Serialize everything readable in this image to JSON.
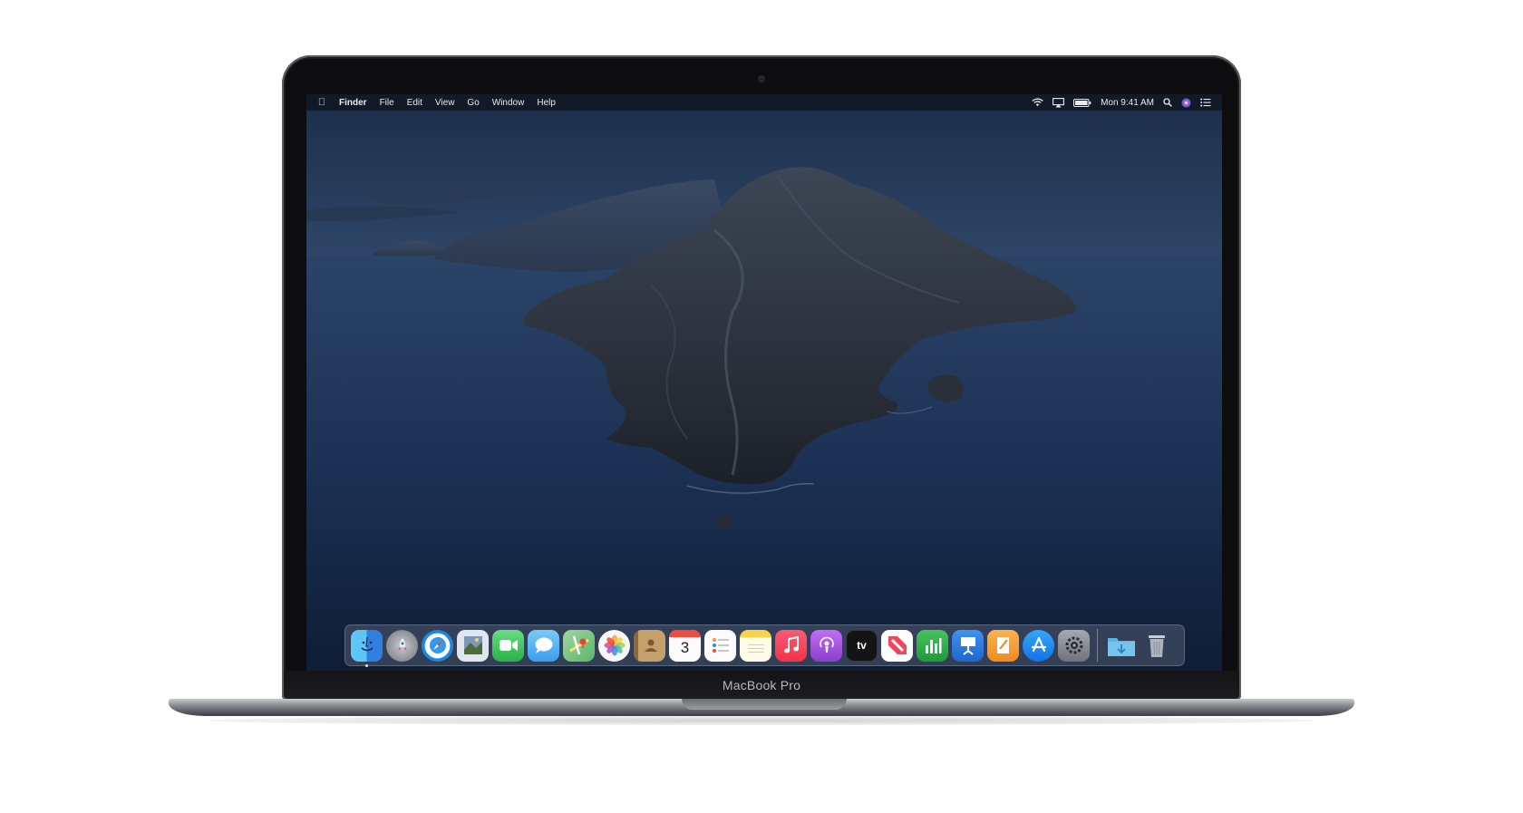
{
  "device": {
    "brand_label": "MacBook Pro"
  },
  "menubar": {
    "apple_icon": "apple-logo-icon",
    "app_name": "Finder",
    "menus": [
      "File",
      "Edit",
      "View",
      "Go",
      "Window",
      "Help"
    ],
    "clock": "Mon 9:41 AM",
    "status_icons": [
      "wifi-icon",
      "airplay-icon",
      "battery-icon",
      "spotlight-search-icon",
      "siri-icon",
      "notification-center-icon"
    ]
  },
  "dock": {
    "apps": [
      {
        "name": "Finder",
        "icon": "finder-icon",
        "color": "#2f8be6"
      },
      {
        "name": "Launchpad",
        "icon": "launchpad-icon",
        "color": "#8a8f98"
      },
      {
        "name": "Safari",
        "icon": "safari-icon",
        "color": "#1d86e0"
      },
      {
        "name": "Photo Booth",
        "icon": "photo-booth-icon",
        "color": "#b8c3d6"
      },
      {
        "name": "FaceTime",
        "icon": "facetime-icon",
        "color": "#35c759"
      },
      {
        "name": "Messages",
        "icon": "messages-icon",
        "color": "#5fb7f5"
      },
      {
        "name": "Maps",
        "icon": "maps-icon",
        "color": "#6fc37b"
      },
      {
        "name": "Photos",
        "icon": "photos-icon",
        "color": "#f2f2f2"
      },
      {
        "name": "Contacts",
        "icon": "contacts-icon",
        "color": "#b9975d"
      },
      {
        "name": "Calendar",
        "icon": "calendar-icon",
        "color": "#f7f7f7",
        "label": "3"
      },
      {
        "name": "Reminders",
        "icon": "reminders-icon",
        "color": "#f5f5f5"
      },
      {
        "name": "Notes",
        "icon": "notes-icon",
        "color": "#f9df6b"
      },
      {
        "name": "Music",
        "icon": "music-icon",
        "color": "#f54a64"
      },
      {
        "name": "Podcasts",
        "icon": "podcasts-icon",
        "color": "#9b4ed6"
      },
      {
        "name": "TV",
        "icon": "apple-tv-icon",
        "color": "#1b1b1d",
        "label": "tv"
      },
      {
        "name": "News",
        "icon": "news-icon",
        "color": "#f34559"
      },
      {
        "name": "Numbers",
        "icon": "numbers-icon",
        "color": "#2bb34a"
      },
      {
        "name": "Keynote",
        "icon": "keynote-icon",
        "color": "#2a7cde"
      },
      {
        "name": "Pages",
        "icon": "pages-icon",
        "color": "#f39b2f"
      },
      {
        "name": "App Store",
        "icon": "app-store-icon",
        "color": "#1a8af5"
      },
      {
        "name": "System Preferences",
        "icon": "system-preferences-icon",
        "color": "#8e9298"
      }
    ],
    "trailing": [
      {
        "name": "Downloads",
        "icon": "downloads-folder-icon",
        "color": "#56aee0"
      },
      {
        "name": "Trash",
        "icon": "trash-icon",
        "color": "#aeb3ba"
      }
    ]
  }
}
